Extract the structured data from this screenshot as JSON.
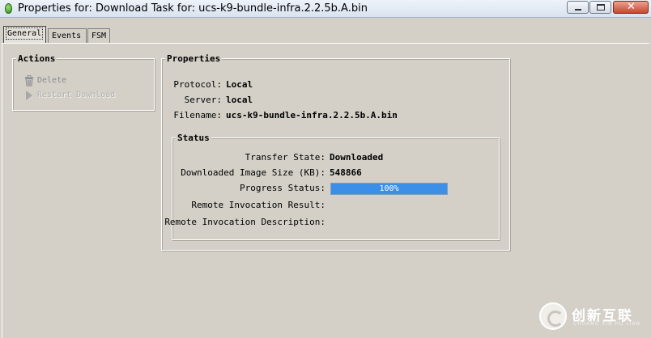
{
  "window": {
    "title": "Properties for: Download Task for: ucs-k9-bundle-infra.2.2.5b.A.bin",
    "close_glyph": "✕"
  },
  "tabs": [
    {
      "label": "General",
      "active": true
    },
    {
      "label": "Events",
      "active": false
    },
    {
      "label": "FSM",
      "active": false
    }
  ],
  "actions": {
    "legend": "Actions",
    "items": [
      {
        "label": "Delete",
        "icon": "trash-icon",
        "enabled": false
      },
      {
        "label": "Restart Download",
        "icon": "play-icon",
        "enabled": false
      }
    ]
  },
  "properties": {
    "legend": "Properties",
    "protocol": {
      "label": "Protocol:",
      "value": "Local"
    },
    "server": {
      "label": "Server:",
      "value": "local"
    },
    "filename": {
      "label": "Filename:",
      "value": "ucs-k9-bundle-infra.2.2.5b.A.bin"
    }
  },
  "status": {
    "legend": "Status",
    "transfer_state": {
      "label": "Transfer State:",
      "value": "Downloaded"
    },
    "image_size": {
      "label": "Downloaded Image Size (KB):",
      "value": "548866"
    },
    "progress": {
      "label": "Progress Status:",
      "percent": 100,
      "text": "100%"
    },
    "remote_result": {
      "label": "Remote Invocation Result:",
      "value": ""
    },
    "remote_description": {
      "label": "Remote Invocation Description:",
      "value": ""
    }
  },
  "watermark": {
    "text": "创新互联",
    "subtext": "CHUANG XIN HU LIAN"
  },
  "colors": {
    "window_bg": "#d4d0c8",
    "progress_fill": "#3b8fe6"
  }
}
